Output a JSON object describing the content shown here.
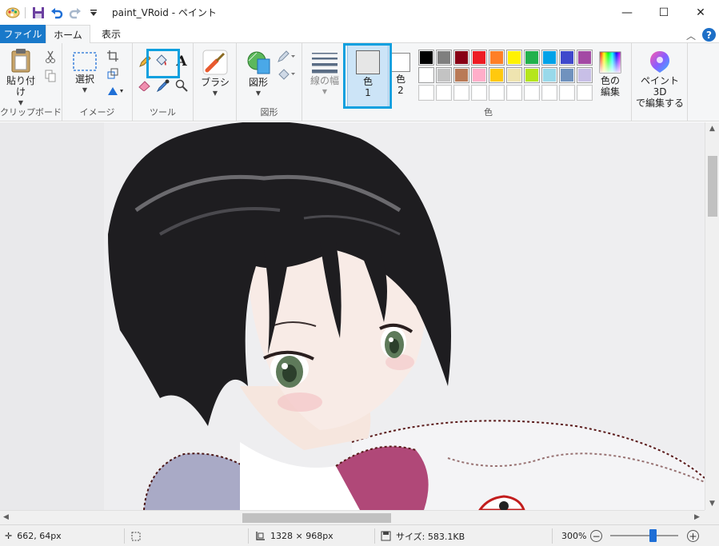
{
  "window": {
    "title": "paint_VRoid - ペイント",
    "controls": {
      "minimize": "—",
      "maximize": "☐",
      "close": "✕"
    }
  },
  "tabs": [
    {
      "label": "ファイル"
    },
    {
      "label": "ホーム"
    },
    {
      "label": "表示"
    }
  ],
  "help": "?",
  "ribbon": {
    "clipboard": {
      "paste_label": "貼り付け",
      "group_label": "クリップボード"
    },
    "image": {
      "select_label": "選択",
      "group_label": "イメージ"
    },
    "tools": {
      "group_label": "ツール",
      "text_tool": "A"
    },
    "brushes": {
      "label": "ブラシ"
    },
    "shapes": {
      "label": "図形",
      "group_label": "図形"
    },
    "line_width": {
      "label": "線の幅"
    },
    "colors": {
      "color1_label": "色",
      "color1_num": "1",
      "color2_label": "色",
      "color2_num": "2",
      "edit_label_1": "色の",
      "edit_label_2": "編集",
      "group_label": "色",
      "color1_value": "#e6e6e6",
      "color2_value": "#ffffff",
      "palette_row1": [
        "#000000",
        "#7f7f7f",
        "#880015",
        "#ed1c24",
        "#ff7f27",
        "#fff200",
        "#22b14c",
        "#00a2e8",
        "#3f48cc",
        "#a349a4"
      ],
      "palette_row2": [
        "#ffffff",
        "#c3c3c3",
        "#b97a57",
        "#ffaec9",
        "#ffc90e",
        "#efe4b0",
        "#b5e61d",
        "#99d9ea",
        "#7092be",
        "#c8bfe7"
      ],
      "palette_row3": [
        "#ffffff",
        "#ffffff",
        "#ffffff",
        "#ffffff",
        "#ffffff",
        "#ffffff",
        "#ffffff",
        "#ffffff",
        "#ffffff",
        "#ffffff"
      ]
    },
    "paint3d": {
      "label_1": "ペイント 3D",
      "label_2": "で編集する"
    }
  },
  "status": {
    "cursor_pos": "662, 64px",
    "image_size": "1328 × 968px",
    "file_size": "サイズ: 583.1KB",
    "zoom": "300%",
    "zoom_level_percent": 300
  },
  "accent": "#1979ca",
  "highlight_color": "#0ea0df"
}
